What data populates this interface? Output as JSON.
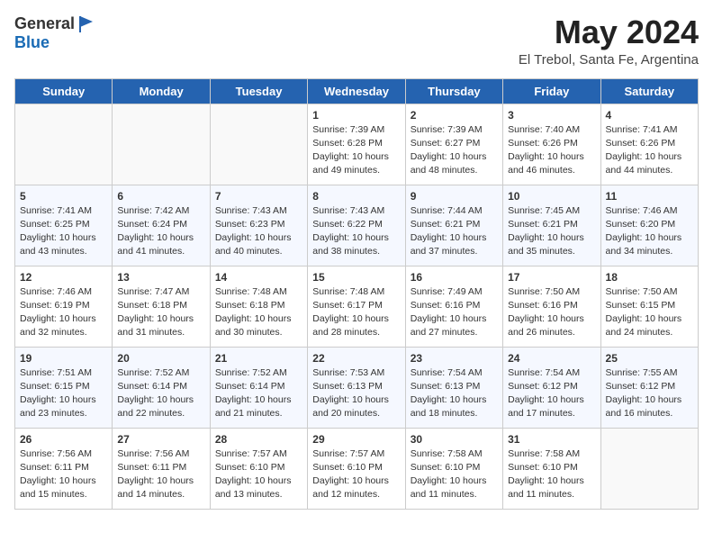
{
  "header": {
    "logo_general": "General",
    "logo_blue": "Blue",
    "title": "May 2024",
    "subtitle": "El Trebol, Santa Fe, Argentina"
  },
  "days_of_week": [
    "Sunday",
    "Monday",
    "Tuesday",
    "Wednesday",
    "Thursday",
    "Friday",
    "Saturday"
  ],
  "weeks": [
    [
      {
        "day": "",
        "info": ""
      },
      {
        "day": "",
        "info": ""
      },
      {
        "day": "",
        "info": ""
      },
      {
        "day": "1",
        "info": "Sunrise: 7:39 AM\nSunset: 6:28 PM\nDaylight: 10 hours\nand 49 minutes."
      },
      {
        "day": "2",
        "info": "Sunrise: 7:39 AM\nSunset: 6:27 PM\nDaylight: 10 hours\nand 48 minutes."
      },
      {
        "day": "3",
        "info": "Sunrise: 7:40 AM\nSunset: 6:26 PM\nDaylight: 10 hours\nand 46 minutes."
      },
      {
        "day": "4",
        "info": "Sunrise: 7:41 AM\nSunset: 6:26 PM\nDaylight: 10 hours\nand 44 minutes."
      }
    ],
    [
      {
        "day": "5",
        "info": "Sunrise: 7:41 AM\nSunset: 6:25 PM\nDaylight: 10 hours\nand 43 minutes."
      },
      {
        "day": "6",
        "info": "Sunrise: 7:42 AM\nSunset: 6:24 PM\nDaylight: 10 hours\nand 41 minutes."
      },
      {
        "day": "7",
        "info": "Sunrise: 7:43 AM\nSunset: 6:23 PM\nDaylight: 10 hours\nand 40 minutes."
      },
      {
        "day": "8",
        "info": "Sunrise: 7:43 AM\nSunset: 6:22 PM\nDaylight: 10 hours\nand 38 minutes."
      },
      {
        "day": "9",
        "info": "Sunrise: 7:44 AM\nSunset: 6:21 PM\nDaylight: 10 hours\nand 37 minutes."
      },
      {
        "day": "10",
        "info": "Sunrise: 7:45 AM\nSunset: 6:21 PM\nDaylight: 10 hours\nand 35 minutes."
      },
      {
        "day": "11",
        "info": "Sunrise: 7:46 AM\nSunset: 6:20 PM\nDaylight: 10 hours\nand 34 minutes."
      }
    ],
    [
      {
        "day": "12",
        "info": "Sunrise: 7:46 AM\nSunset: 6:19 PM\nDaylight: 10 hours\nand 32 minutes."
      },
      {
        "day": "13",
        "info": "Sunrise: 7:47 AM\nSunset: 6:18 PM\nDaylight: 10 hours\nand 31 minutes."
      },
      {
        "day": "14",
        "info": "Sunrise: 7:48 AM\nSunset: 6:18 PM\nDaylight: 10 hours\nand 30 minutes."
      },
      {
        "day": "15",
        "info": "Sunrise: 7:48 AM\nSunset: 6:17 PM\nDaylight: 10 hours\nand 28 minutes."
      },
      {
        "day": "16",
        "info": "Sunrise: 7:49 AM\nSunset: 6:16 PM\nDaylight: 10 hours\nand 27 minutes."
      },
      {
        "day": "17",
        "info": "Sunrise: 7:50 AM\nSunset: 6:16 PM\nDaylight: 10 hours\nand 26 minutes."
      },
      {
        "day": "18",
        "info": "Sunrise: 7:50 AM\nSunset: 6:15 PM\nDaylight: 10 hours\nand 24 minutes."
      }
    ],
    [
      {
        "day": "19",
        "info": "Sunrise: 7:51 AM\nSunset: 6:15 PM\nDaylight: 10 hours\nand 23 minutes."
      },
      {
        "day": "20",
        "info": "Sunrise: 7:52 AM\nSunset: 6:14 PM\nDaylight: 10 hours\nand 22 minutes."
      },
      {
        "day": "21",
        "info": "Sunrise: 7:52 AM\nSunset: 6:14 PM\nDaylight: 10 hours\nand 21 minutes."
      },
      {
        "day": "22",
        "info": "Sunrise: 7:53 AM\nSunset: 6:13 PM\nDaylight: 10 hours\nand 20 minutes."
      },
      {
        "day": "23",
        "info": "Sunrise: 7:54 AM\nSunset: 6:13 PM\nDaylight: 10 hours\nand 18 minutes."
      },
      {
        "day": "24",
        "info": "Sunrise: 7:54 AM\nSunset: 6:12 PM\nDaylight: 10 hours\nand 17 minutes."
      },
      {
        "day": "25",
        "info": "Sunrise: 7:55 AM\nSunset: 6:12 PM\nDaylight: 10 hours\nand 16 minutes."
      }
    ],
    [
      {
        "day": "26",
        "info": "Sunrise: 7:56 AM\nSunset: 6:11 PM\nDaylight: 10 hours\nand 15 minutes."
      },
      {
        "day": "27",
        "info": "Sunrise: 7:56 AM\nSunset: 6:11 PM\nDaylight: 10 hours\nand 14 minutes."
      },
      {
        "day": "28",
        "info": "Sunrise: 7:57 AM\nSunset: 6:10 PM\nDaylight: 10 hours\nand 13 minutes."
      },
      {
        "day": "29",
        "info": "Sunrise: 7:57 AM\nSunset: 6:10 PM\nDaylight: 10 hours\nand 12 minutes."
      },
      {
        "day": "30",
        "info": "Sunrise: 7:58 AM\nSunset: 6:10 PM\nDaylight: 10 hours\nand 11 minutes."
      },
      {
        "day": "31",
        "info": "Sunrise: 7:58 AM\nSunset: 6:10 PM\nDaylight: 10 hours\nand 11 minutes."
      },
      {
        "day": "",
        "info": ""
      }
    ]
  ]
}
